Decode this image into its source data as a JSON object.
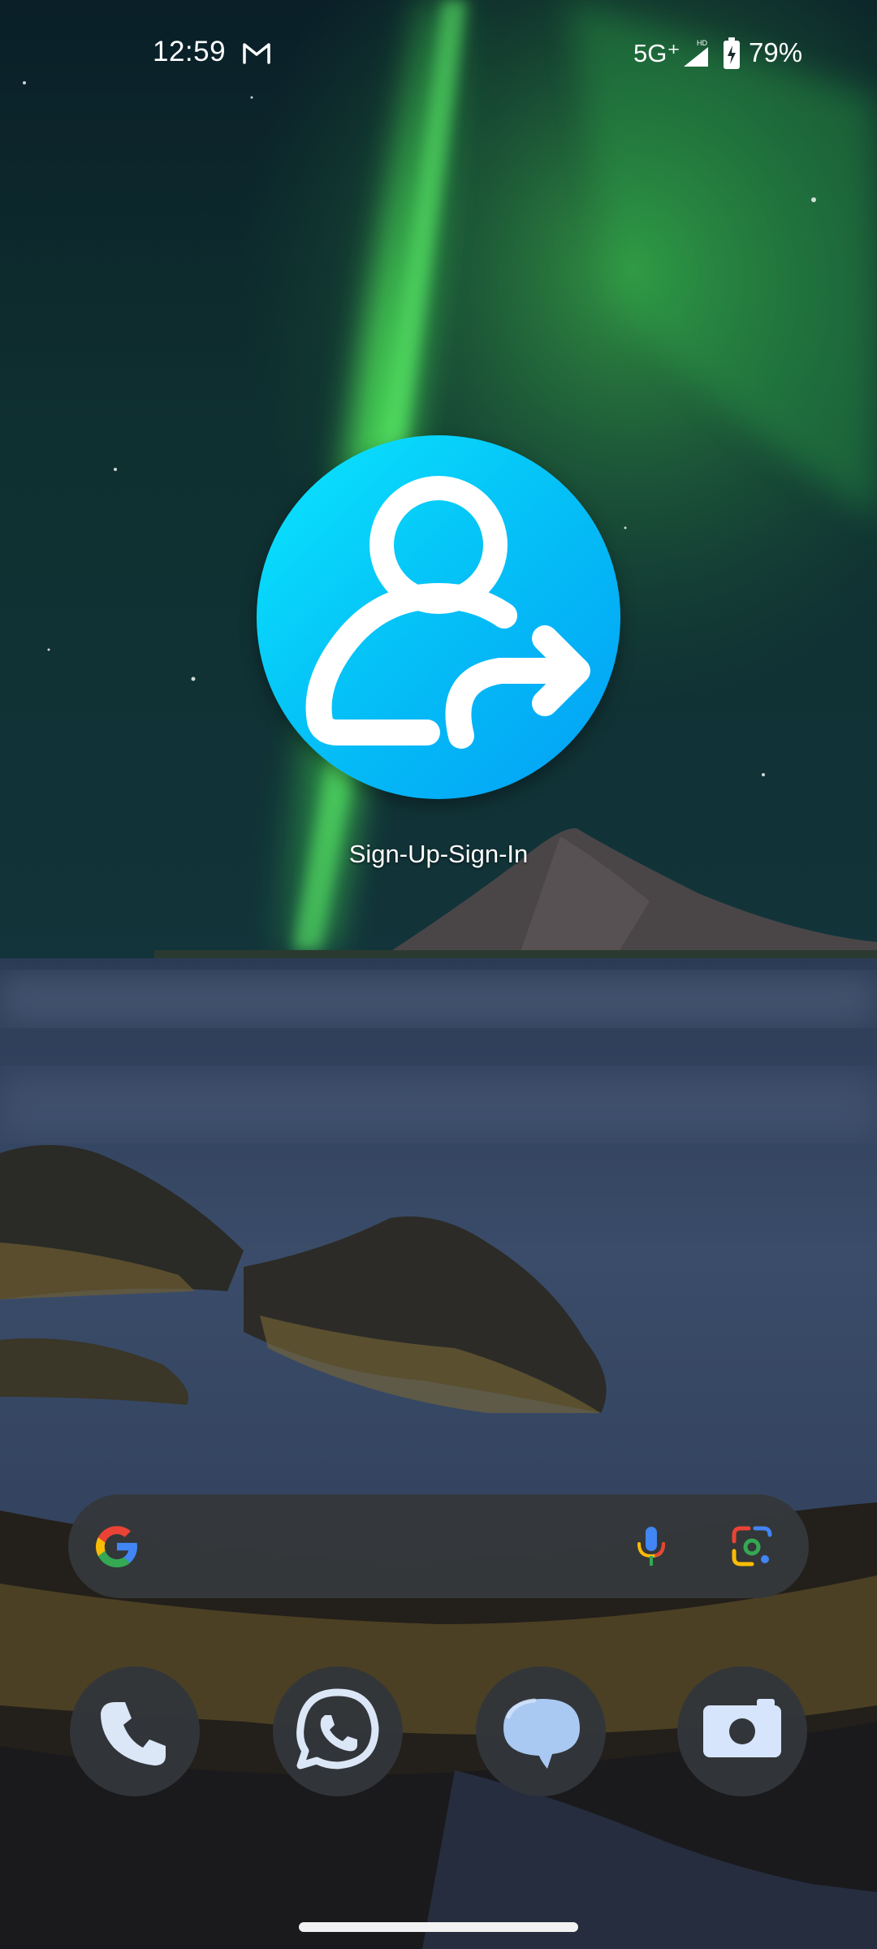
{
  "status_bar": {
    "time": "12:59",
    "notification_icons": [
      "gmail-icon"
    ],
    "network": "5G⁺",
    "signal_badge": "HD",
    "battery_percent": "79%",
    "battery_charging": true
  },
  "home": {
    "app": {
      "label": "Sign-Up-Sign-In",
      "icon": "user-arrow-icon",
      "accent_color": "#05c3f7"
    }
  },
  "search_bar": {
    "icons": [
      "google-g-icon",
      "microphone-icon",
      "google-lens-icon"
    ]
  },
  "dock": {
    "items": [
      {
        "name": "Phone",
        "icon": "phone-icon"
      },
      {
        "name": "WhatsApp",
        "icon": "whatsapp-icon"
      },
      {
        "name": "Messages",
        "icon": "messages-icon"
      },
      {
        "name": "Camera",
        "icon": "camera-icon"
      }
    ]
  },
  "colors": {
    "dock_bg": "#32363a",
    "search_bg": "#34383a",
    "aurora_green": "#3fcf4f"
  }
}
